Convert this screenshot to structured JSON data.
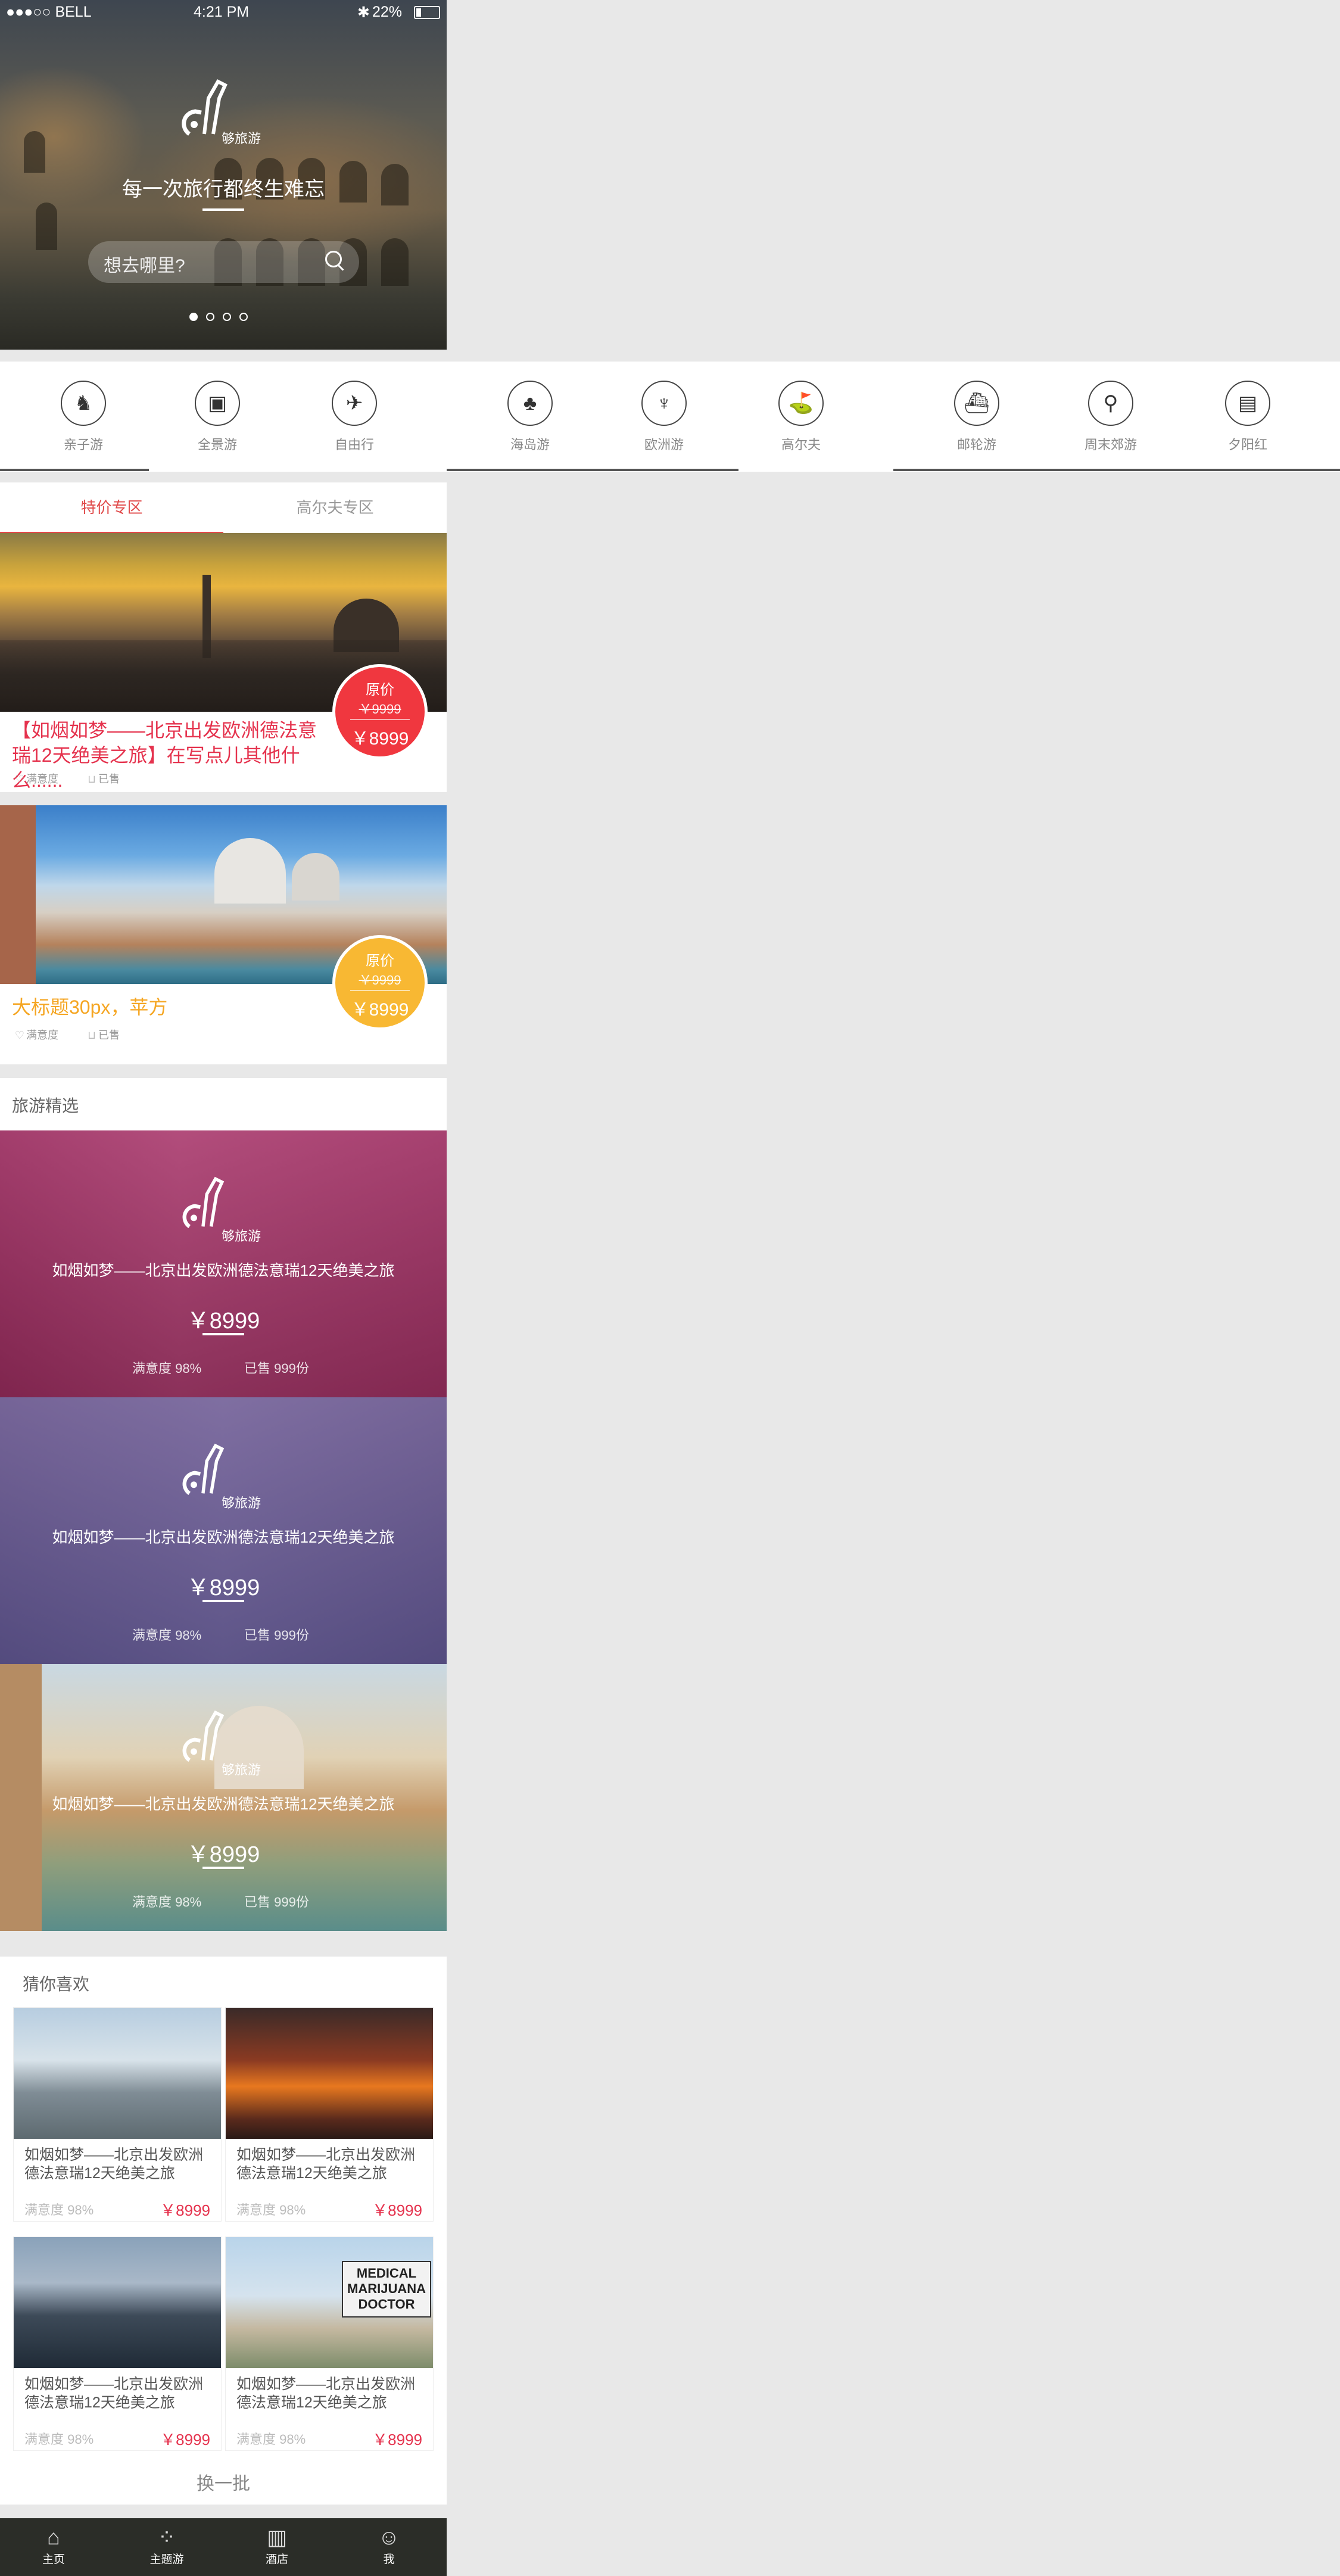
{
  "status": {
    "carrier": "●●●○○ BELL",
    "time": "4:21 PM",
    "battery": "22%"
  },
  "hero": {
    "brand": "够旅游",
    "slogan": "每一次旅行都终生难忘",
    "search_placeholder": "想去哪里?"
  },
  "categories": [
    {
      "label": "亲子游",
      "icon": "rocking-horse-icon",
      "glyph": "♞"
    },
    {
      "label": "全景游",
      "icon": "panorama-card-icon",
      "glyph": "▣"
    },
    {
      "label": "自由行",
      "icon": "free-travel-icon",
      "glyph": "✈"
    },
    {
      "label": "海岛游",
      "icon": "palm-island-icon",
      "glyph": "♣"
    },
    {
      "label": "欧洲游",
      "icon": "eiffel-tower-icon",
      "glyph": "♆"
    },
    {
      "label": "高尔夫",
      "icon": "golf-icon",
      "glyph": "⛳"
    },
    {
      "label": "邮轮游",
      "icon": "cruise-ship-icon",
      "glyph": "⛴"
    },
    {
      "label": "周末郊游",
      "icon": "bicycle-icon",
      "glyph": "⚲"
    },
    {
      "label": "夕阳红",
      "icon": "radio-icon",
      "glyph": "▤"
    }
  ],
  "specials": {
    "tabs": [
      "特价专区",
      "高尔夫专区"
    ],
    "items": [
      {
        "title_main": "【如烟如梦——北京出发欧洲德法意瑞12天绝美之旅】",
        "title_sub": "在写点儿其他什么......",
        "badge_label": "原价",
        "badge_old": "￥9999",
        "badge_price": "￥8999",
        "satisfaction": "满意度",
        "sold": "已售",
        "badge_color": "#f0373f"
      },
      {
        "title_main": "大标题30px，苹方",
        "title_sub": "",
        "badge_label": "原价",
        "badge_old": "￥9999",
        "badge_price": "￥8999",
        "satisfaction": "满意度",
        "sold": "已售",
        "badge_color": "#f8b833"
      }
    ]
  },
  "selection": {
    "title": "旅游精选",
    "items": [
      {
        "brand": "够旅游",
        "title": "如烟如梦——北京出发欧洲德法意瑞12天绝美之旅",
        "price": "￥8999",
        "satisfaction": "满意度 98%",
        "sold": "已售 999份"
      },
      {
        "brand": "够旅游",
        "title": "如烟如梦——北京出发欧洲德法意瑞12天绝美之旅",
        "price": "￥8999",
        "satisfaction": "满意度 98%",
        "sold": "已售 999份"
      },
      {
        "brand": "够旅游",
        "title": "如烟如梦——北京出发欧洲德法意瑞12天绝美之旅",
        "price": "￥8999",
        "satisfaction": "满意度 98%",
        "sold": "已售 999份"
      }
    ]
  },
  "guess": {
    "title": "猜你喜欢",
    "items": [
      {
        "title": "如烟如梦——北京出发欧洲德法意瑞12天绝美之旅",
        "satisfaction": "满意度 98%",
        "price": "￥8999"
      },
      {
        "title": "如烟如梦——北京出发欧洲德法意瑞12天绝美之旅",
        "satisfaction": "满意度 98%",
        "price": "￥8999"
      },
      {
        "title": "如烟如梦——北京出发欧洲德法意瑞12天绝美之旅",
        "satisfaction": "满意度 98%",
        "price": "￥8999"
      },
      {
        "title": "如烟如梦——北京出发欧洲德法意瑞12天绝美之旅",
        "satisfaction": "满意度 98%",
        "price": "￥8999"
      }
    ],
    "sign_text": "MEDICAL MARIJUANA DOCTOR",
    "refresh": "换一批"
  },
  "tabbar": [
    {
      "label": "主页",
      "icon": "home-icon",
      "glyph": "⌂"
    },
    {
      "label": "主题游",
      "icon": "theme-grid-icon",
      "glyph": "⁘"
    },
    {
      "label": "酒店",
      "icon": "hotel-building-icon",
      "glyph": "▥"
    },
    {
      "label": "我",
      "icon": "profile-icon",
      "glyph": "☺"
    }
  ]
}
